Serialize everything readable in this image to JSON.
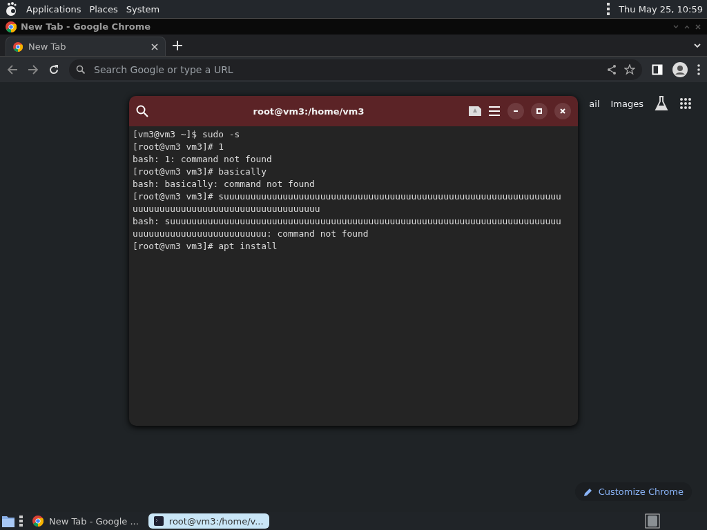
{
  "top_panel": {
    "menus": [
      "Applications",
      "Places",
      "System"
    ],
    "clock": "Thu May 25, 10:59"
  },
  "browser": {
    "window_title": "New Tab - Google Chrome",
    "tabs": [
      {
        "label": "New Tab",
        "selected": true
      }
    ],
    "address_bar": {
      "placeholder": "Search Google or type a URL"
    },
    "header_links": [
      "ail",
      "Images"
    ],
    "customize_button": "Customize Chrome"
  },
  "terminal": {
    "title": "root@vm3:/home/vm3",
    "lines": [
      "[vm3@vm3 ~]$ sudo -s",
      "[root@vm3 vm3]# 1",
      "bash: 1: command not found",
      "[root@vm3 vm3]# basically",
      "bash: basically: command not found",
      "[root@vm3 vm3]# suuuuuuuuuuuuuuuuuuuuuuuuuuuuuuuuuuuuuuuuuuuuuuuuuuuuuuuuuuuuuuu",
      "uuuuuuuuuuuuuuuuuuuuuuuuuuuuuuuuuuu",
      "bash: suuuuuuuuuuuuuuuuuuuuuuuuuuuuuuuuuuuuuuuuuuuuuuuuuuuuuuuuuuuuuuuuuuuuuuuuu",
      "uuuuuuuuuuuuuuuuuuuuuuuuu: command not found",
      "[root@vm3 vm3]# apt install"
    ]
  },
  "taskbar": {
    "items": [
      {
        "kind": "browser",
        "label": "New Tab - Google ...",
        "selected": false
      },
      {
        "kind": "terminal",
        "label": "root@vm3:/home/v...",
        "selected": true
      }
    ]
  }
}
